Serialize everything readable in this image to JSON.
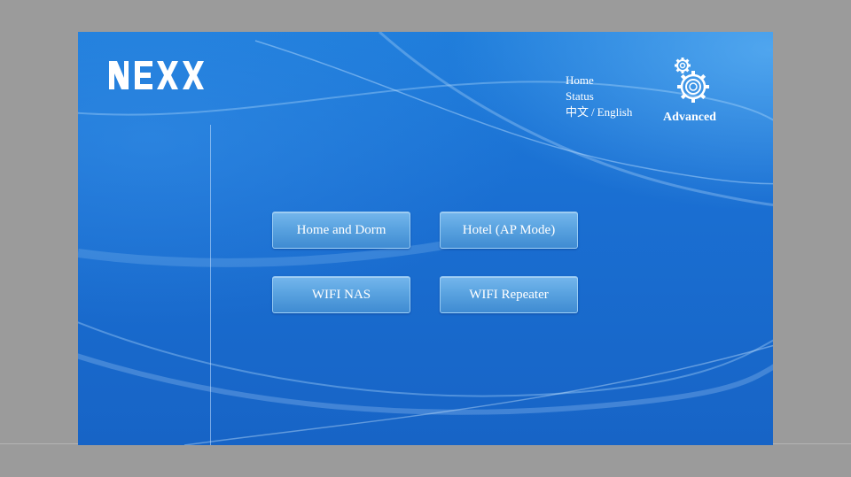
{
  "brand": {
    "logo_text": "NEXX"
  },
  "nav": {
    "home": "Home",
    "status": "Status",
    "lang_chinese": "中文",
    "lang_separator": "/",
    "lang_english": "English",
    "advanced": "Advanced"
  },
  "modes": [
    {
      "label": "Home and Dorm"
    },
    {
      "label": "Hotel (AP Mode)"
    },
    {
      "label": "WIFI NAS"
    },
    {
      "label": "WIFI Repeater"
    }
  ],
  "icons": {
    "advanced": "gears-icon"
  },
  "colors": {
    "background_gray": "#9b9b9b",
    "panel_blue": "#1a6fd2",
    "button_blue": "#5aa3e0",
    "text_white": "#ffffff"
  }
}
